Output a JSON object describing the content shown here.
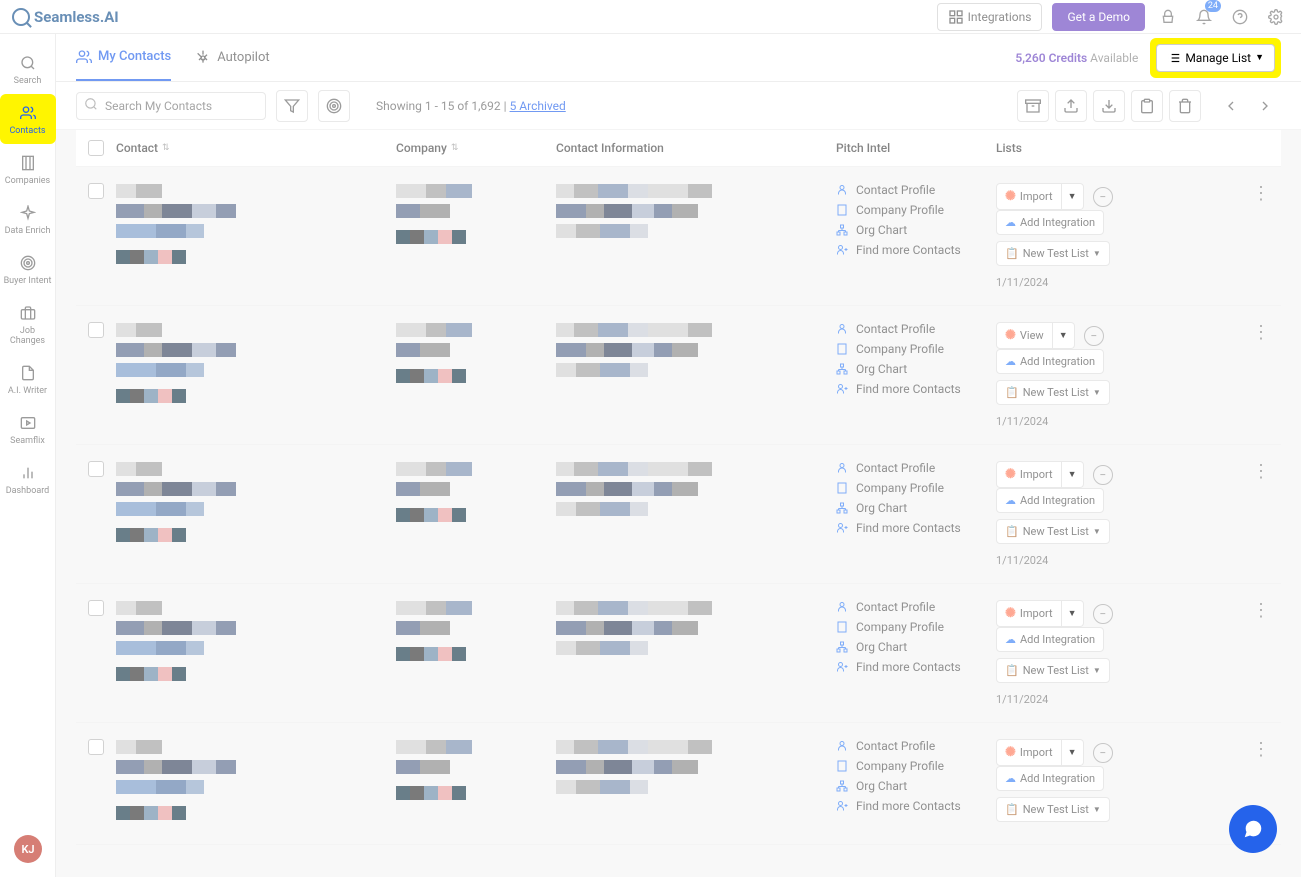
{
  "brand": "Seamless.AI",
  "topbar": {
    "integrations": "Integrations",
    "get_demo": "Get a Demo",
    "notif_count": "24"
  },
  "sidebar": {
    "items": [
      {
        "label": "Search"
      },
      {
        "label": "Contacts"
      },
      {
        "label": "Companies"
      },
      {
        "label": "Data Enrich"
      },
      {
        "label": "Buyer Intent"
      },
      {
        "label": "Job Changes"
      },
      {
        "label": "A.I. Writer"
      },
      {
        "label": "Seamflix"
      },
      {
        "label": "Dashboard"
      }
    ],
    "avatar": "KJ"
  },
  "tabs": {
    "my_contacts": "My Contacts",
    "autopilot": "Autopilot"
  },
  "credits": {
    "num": "5,260 Credits",
    "avail": "Available"
  },
  "manage_list": "Manage List",
  "search_placeholder": "Search My Contacts",
  "showing_prefix": "Showing 1 - 15 of 1,692",
  "showing_sep": "  |  ",
  "archived_link": "5 Archived",
  "columns": {
    "contact": "Contact",
    "company": "Company",
    "info": "Contact Information",
    "pitch": "Pitch Intel",
    "lists": "Lists"
  },
  "pitch_links": {
    "contact_profile": "Contact Profile",
    "company_profile": "Company Profile",
    "org_chart": "Org Chart",
    "find_more": "Find more Contacts"
  },
  "list_actions": {
    "import": "Import",
    "view": "View",
    "add_integration": "Add Integration",
    "new_test_list": "New Test List"
  },
  "rows": [
    {
      "action": "import",
      "date": "1/11/2024"
    },
    {
      "action": "view",
      "date": "1/11/2024"
    },
    {
      "action": "import",
      "date": "1/11/2024"
    },
    {
      "action": "import",
      "date": "1/11/2024"
    },
    {
      "action": "import",
      "date": ""
    }
  ]
}
